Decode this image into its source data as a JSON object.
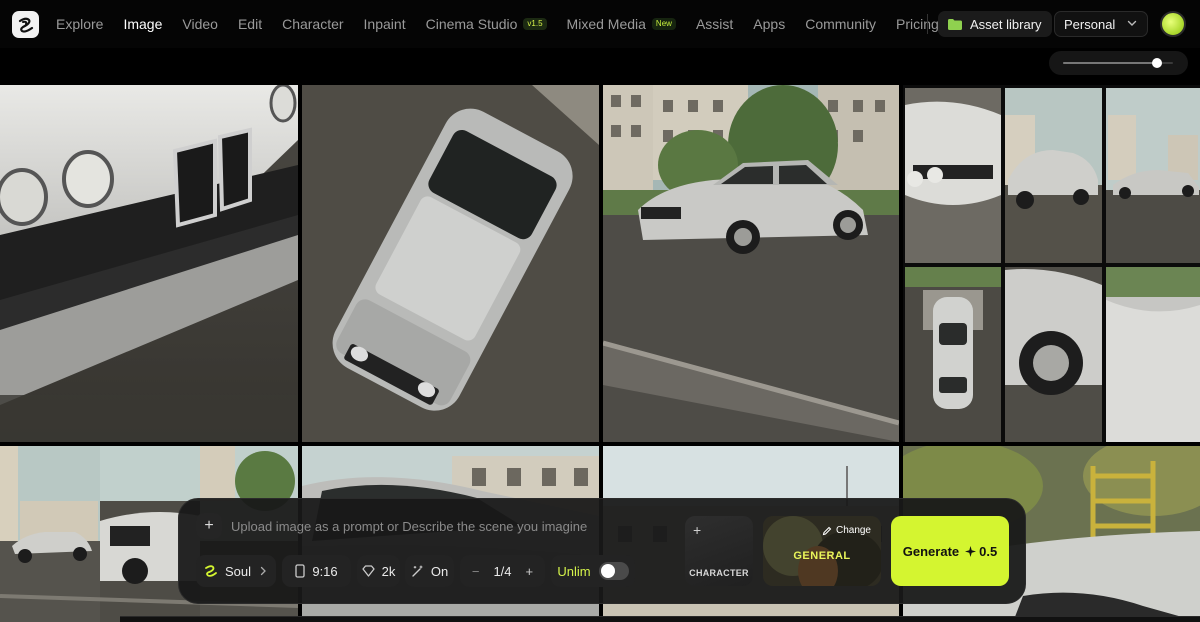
{
  "nav": {
    "items": [
      {
        "label": "Explore",
        "active": false
      },
      {
        "label": "Image",
        "active": true
      },
      {
        "label": "Video",
        "active": false
      },
      {
        "label": "Edit",
        "active": false
      },
      {
        "label": "Character",
        "active": false
      },
      {
        "label": "Inpaint",
        "active": false
      },
      {
        "label": "Cinema Studio",
        "badge": "v1.5",
        "active": false
      },
      {
        "label": "Mixed Media",
        "badge": "New",
        "active": false
      },
      {
        "label": "Assist",
        "active": false
      },
      {
        "label": "Apps",
        "active": false
      },
      {
        "label": "Community",
        "active": false
      },
      {
        "label": "Pricing",
        "active": false
      }
    ],
    "asset_library": "Asset library",
    "workspace": "Personal",
    "accent": "#d4f530"
  },
  "gallery": {
    "zoom_level": 0.85,
    "tiles": [
      {
        "subject": "headlights-closeup"
      },
      {
        "subject": "car-top-view"
      },
      {
        "subject": "car-parked-buildings"
      },
      {
        "subject": "grid-of-car-shots"
      },
      {
        "subject": "car-street"
      },
      {
        "subject": "car-windshield"
      },
      {
        "subject": "buildings-sky"
      },
      {
        "subject": "car-hood-playground"
      }
    ]
  },
  "prompt_bar": {
    "placeholder": "Upload image as a prompt or Describe the scene you imagine",
    "model": "Soul",
    "aspect": "9:16",
    "quality": "2k",
    "enhance": "On",
    "count": "1/4",
    "unlim": "Unlim",
    "character_label": "CHARACTER",
    "style_change": "Change",
    "style_name": "GENERAL",
    "generate_label": "Generate",
    "generate_cost": "0.5"
  }
}
